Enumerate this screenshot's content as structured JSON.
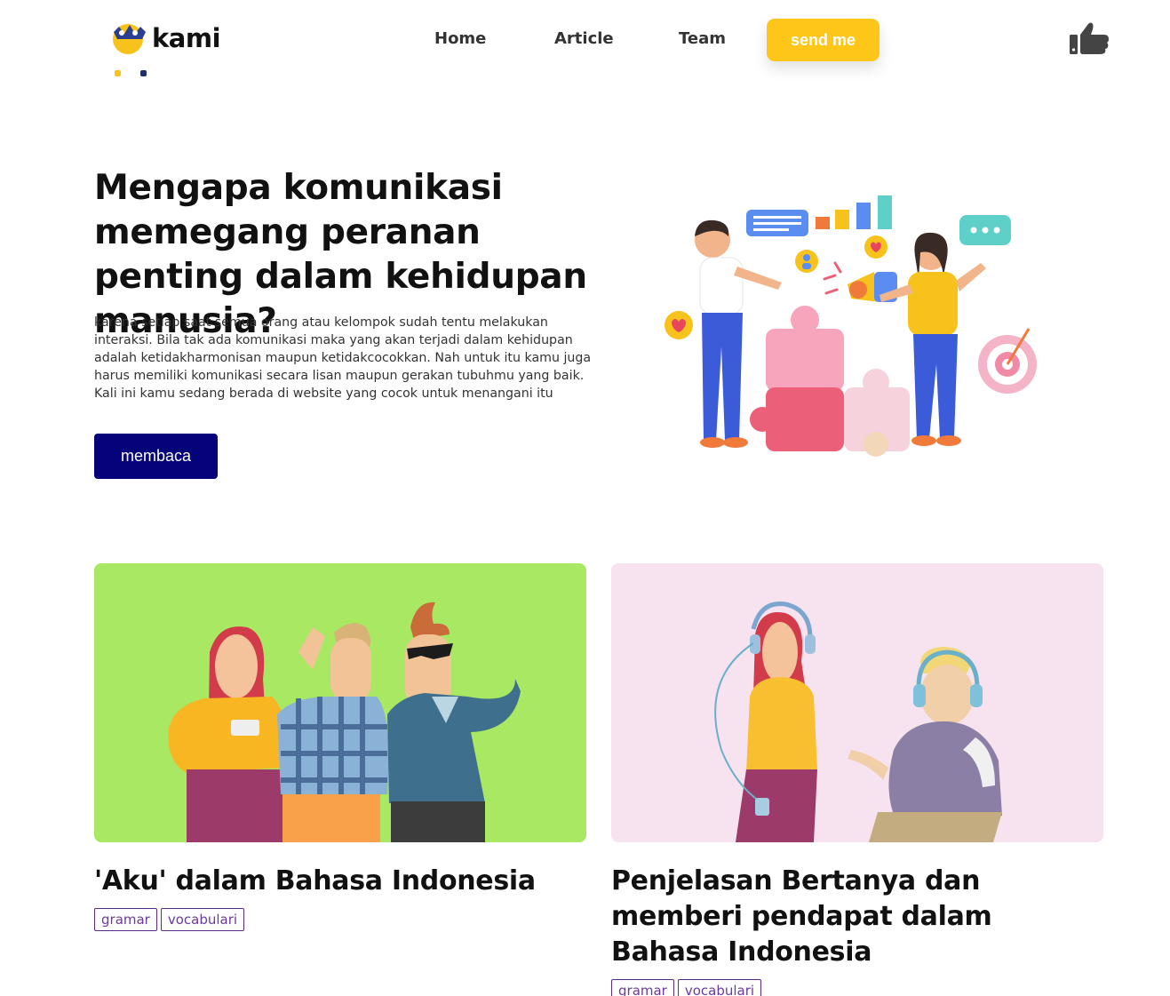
{
  "brand": {
    "name": "kami"
  },
  "nav": {
    "items": [
      {
        "label": "Home"
      },
      {
        "label": "Article"
      },
      {
        "label": "Team"
      }
    ],
    "cta_label": "send me"
  },
  "icons": {
    "like": "thumbs-up-icon"
  },
  "colors": {
    "accent_yellow": "#fec619",
    "primary_navy": "#06037a",
    "tag_purple": "#5a2a86"
  },
  "hero": {
    "title": "Mengapa komunikasi memegang peranan penting dalam kehidupan manusia?",
    "body": "karena setiap saat semua orang atau kelompok sudah tentu melakukan interaksi. Bila tak ada komunikasi maka yang akan terjadi dalam kehidupan adalah ketidakharmonisan maupun ketidakcocokkan. Nah untuk itu kamu juga harus memiliki komunikasi secara lisan maupun gerakan tubuhmu yang baik. Kali ini kamu sedang berada di website yang cocok untuk menangani itu",
    "button_label": "membaca"
  },
  "articles": [
    {
      "title": "'Aku' dalam Bahasa Indonesia",
      "tags": [
        "gramar",
        "vocabulari"
      ]
    },
    {
      "title": "Penjelasan Bertanya dan memberi pendapat dalam Bahasa Indonesia",
      "tags": [
        "gramar",
        "vocabulari"
      ]
    }
  ]
}
